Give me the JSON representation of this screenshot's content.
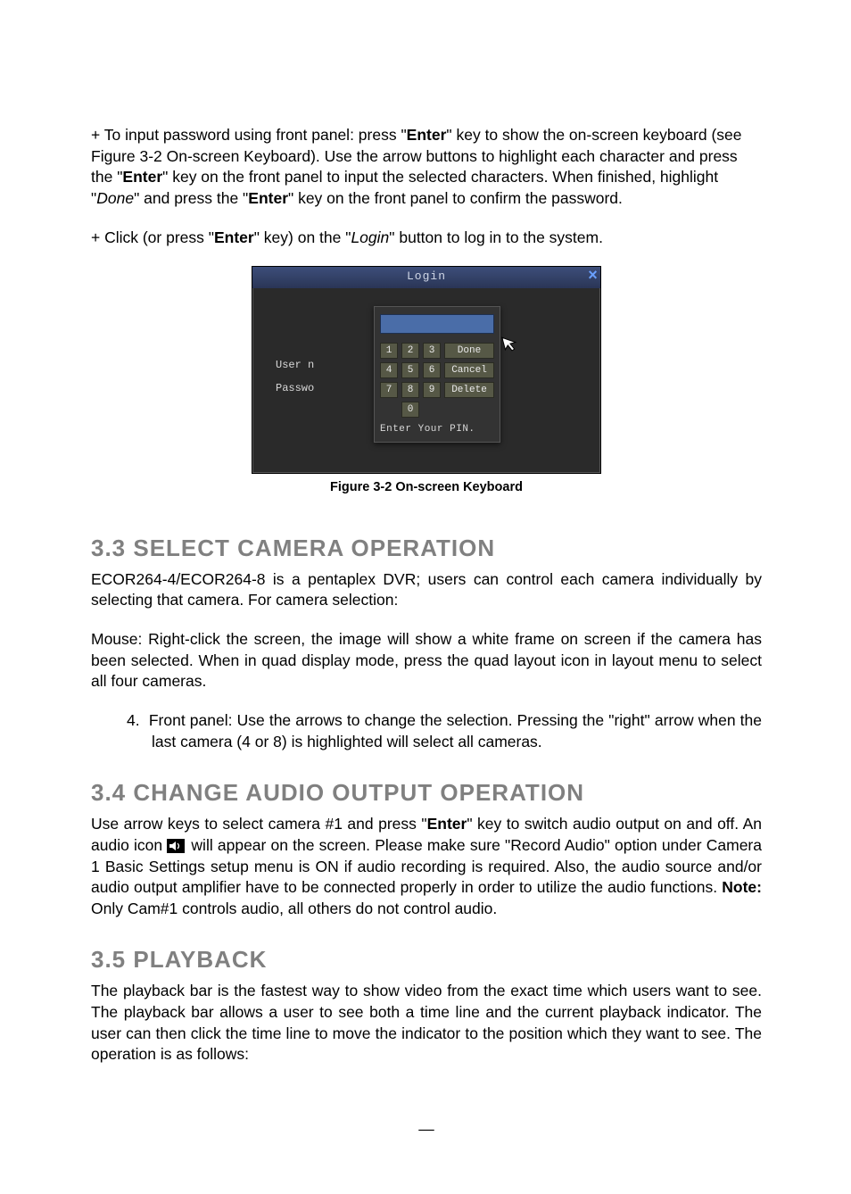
{
  "para1": {
    "prefix": "+ To input password using front panel: press \"",
    "enter1": "Enter",
    "mid1": "\" key to show the on-screen keyboard (see Figure 3-2 On-screen Keyboard). Use the arrow buttons to highlight each character and press the \"",
    "enter2": "Enter",
    "mid2": "\" key on the front panel to input the selected characters. When finished, highlight \"",
    "done": "Done",
    "mid3": "\" and press the \"",
    "enter3": "Enter",
    "suffix": "\" key on the front panel to confirm the password."
  },
  "para2": {
    "prefix": "+ Click (or press \"",
    "enter": "Enter",
    "mid1": "\" key) on the \"",
    "login": "Login",
    "suffix": "\" button to log in to the system."
  },
  "login": {
    "title": "Login",
    "user_label": "User n",
    "pass_label": "Passwo",
    "pin_msg": "Enter Your PIN.",
    "keys": {
      "r1": [
        "1",
        "2",
        "3"
      ],
      "r1wide": "Done",
      "r2": [
        "4",
        "5",
        "6"
      ],
      "r2wide": "Cancel",
      "r3": [
        "7",
        "8",
        "9"
      ],
      "r3wide": "Delete",
      "zero": "0"
    },
    "close": "×"
  },
  "figcaption": "Figure 3-2 On-screen Keyboard",
  "sec33": {
    "heading": "3.3  SELECT CAMERA OPERATION",
    "p1": "ECOR264-4/ECOR264-8 is a pentaplex DVR; users can control each camera individually by selecting that camera. For camera selection:",
    "p2": "Mouse: Right-click the screen, the image will show a white frame on screen if the camera has been selected. When in quad display mode, press the quad layout icon in layout menu to select all four cameras.",
    "li_num": "4.",
    "li": "Front panel:  Use the arrows to change the selection. Pressing the \"right\" arrow when the last camera (4 or 8) is highlighted will select all cameras."
  },
  "sec34": {
    "heading": "3.4 CHANGE AUDIO OUTPUT OPERATION",
    "p_pre": "Use arrow keys to select camera #1 and press \"",
    "enter": "Enter",
    "p_mid": "\" key to switch audio output on and off. An audio icon ",
    "p_post1": " will appear on the screen. Please make sure \"Record Audio\" option under Camera 1 Basic Settings setup menu is ON if audio recording is required. Also, the audio source and/or audio output amplifier have to be connected properly in order to utilize the audio functions. ",
    "note_label": "Note:",
    "note_text": " Only Cam#1 controls audio, all others do not control audio."
  },
  "sec35": {
    "heading": "3.5  PLAYBACK",
    "p": "The playback bar is the fastest way to show video from the exact time which users want to see. The playback bar allows a user to see both a time line and the current playback indicator. The user can then click the time line to move the indicator to the position which they want to see. The operation is as follows:"
  }
}
